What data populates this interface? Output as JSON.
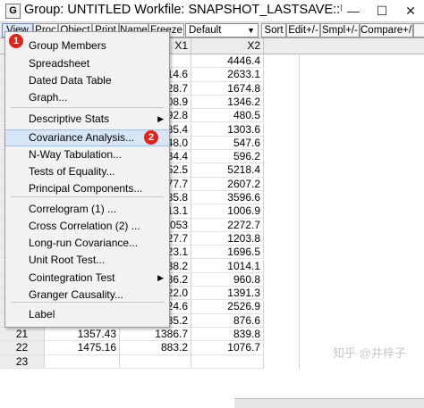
{
  "window": {
    "title": "Group: UNTITLED   Workfile: SNAPSHOT_LASTSAVE::Untitle...",
    "icon_letter": "G",
    "controls": {
      "minimize": "—",
      "maximize": "☐",
      "close": "✕"
    }
  },
  "toolbar": {
    "view": "View",
    "proc": "Proc",
    "object": "Object",
    "print": "Print",
    "name": "Name",
    "freeze": "Freeze",
    "format_value": "Default",
    "sort": "Sort",
    "edit": "Edit+/-",
    "smpl": "Smpl+/-",
    "compare": "Compare+/-"
  },
  "grid": {
    "headers": {
      "x1": "X1",
      "x2": "X2"
    },
    "rows": [
      {
        "obs": "",
        "x0": "",
        "x1": "",
        "x2": "4446.4"
      },
      {
        "obs": "",
        "x0": "",
        "x1": "14.6",
        "x2": "2633.1"
      },
      {
        "obs": "",
        "x0": "",
        "x1": "28.7",
        "x2": "1674.8"
      },
      {
        "obs": "",
        "x0": "",
        "x1": "08.9",
        "x2": "1346.2"
      },
      {
        "obs": "",
        "x0": "",
        "x1": "92.8",
        "x2": "480.5"
      },
      {
        "obs": "",
        "x0": "",
        "x1": "85.4",
        "x2": "1303.6"
      },
      {
        "obs": "",
        "x0": "",
        "x1": "48.0",
        "x2": "547.6"
      },
      {
        "obs": "",
        "x0": "",
        "x1": "84.4",
        "x2": "596.2"
      },
      {
        "obs": "",
        "x0": "",
        "x1": "52.5",
        "x2": "5218.4"
      },
      {
        "obs": "",
        "x0": "",
        "x1": "77.7",
        "x2": "2607.2"
      },
      {
        "obs": "",
        "x0": "",
        "x1": "85.8",
        "x2": "3596.6"
      },
      {
        "obs": "",
        "x0": "",
        "x1": "13.1",
        "x2": "1006.9"
      },
      {
        "obs": "",
        "x0": "",
        "x1": "053",
        "x2": "2272.7"
      },
      {
        "obs": "",
        "x0": "",
        "x1": "27.7",
        "x2": "1203.8"
      },
      {
        "obs": "",
        "x0": "",
        "x1": "23.1",
        "x2": "1696.5"
      },
      {
        "obs": "",
        "x0": "",
        "x1": "38.2",
        "x2": "1014.1"
      },
      {
        "obs": "",
        "x0": "",
        "x1": "36.2",
        "x2": "960.8"
      },
      {
        "obs": "",
        "x0": "",
        "x1": "22.0",
        "x2": "1391.3"
      },
      {
        "obs": "",
        "x0": "",
        "x1": "24.6",
        "x2": "2526.9"
      },
      {
        "obs": "",
        "x0": "",
        "x1": "85.2",
        "x2": "876.6"
      },
      {
        "obs": "21",
        "x0": "1357.43",
        "x1": "1386.7",
        "x2": "839.8"
      },
      {
        "obs": "22",
        "x0": "1475.16",
        "x1": "883.2",
        "x2": "1076.7"
      },
      {
        "obs": "23",
        "x0": "",
        "x1": "",
        "x2": ""
      }
    ]
  },
  "menu": {
    "items": [
      {
        "label": "Group Members"
      },
      {
        "label": "Spreadsheet"
      },
      {
        "label": "Dated Data Table"
      },
      {
        "label": "Graph..."
      },
      {
        "label": "Descriptive Stats",
        "submenu": true
      },
      {
        "label": "Covariance Analysis...",
        "highlighted": true
      },
      {
        "label": "N-Way Tabulation..."
      },
      {
        "label": "Tests of Equality..."
      },
      {
        "label": "Principal Components..."
      },
      {
        "label": "Correlogram (1) ..."
      },
      {
        "label": "Cross Correlation (2) ..."
      },
      {
        "label": "Long-run Covariance..."
      },
      {
        "label": "Unit Root Test..."
      },
      {
        "label": "Cointegration Test",
        "submenu": true
      },
      {
        "label": "Granger Causality..."
      },
      {
        "label": "Label"
      }
    ],
    "submenu_arrow": "▶"
  },
  "badges": {
    "step1": "1",
    "step2": "2"
  },
  "watermark": "知乎 @井梓子",
  "colors": {
    "badge": "#e0231b",
    "highlight": "#d6e6f7"
  }
}
